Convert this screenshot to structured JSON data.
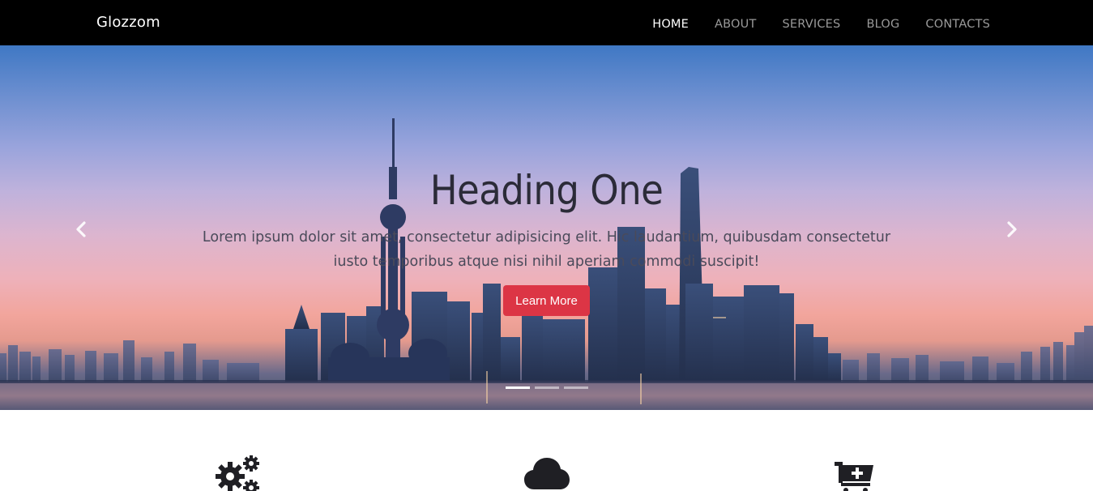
{
  "navbar": {
    "brand": "Glozzom",
    "links": [
      {
        "label": "HOME",
        "active": true
      },
      {
        "label": "ABOUT",
        "active": false
      },
      {
        "label": "SERVICES",
        "active": false
      },
      {
        "label": "BLOG",
        "active": false
      },
      {
        "label": "CONTACTS",
        "active": false
      }
    ]
  },
  "carousel": {
    "heading": "Heading One",
    "text": "Lorem ipsum dolor sit amet, consectetur adipisicing elit. Hic laudantium, quibusdam consectetur iusto temporibus atque nisi nihil aperiam commodi suscipit!",
    "button_label": "Learn More",
    "button_color": "#dc3545",
    "prev_icon": "chevron-left-icon",
    "next_icon": "chevron-right-icon",
    "slide_count": 3,
    "active_slide": 1
  },
  "features": {
    "icons": [
      "gears-icon",
      "cloud-icon",
      "cart-plus-icon"
    ]
  }
}
